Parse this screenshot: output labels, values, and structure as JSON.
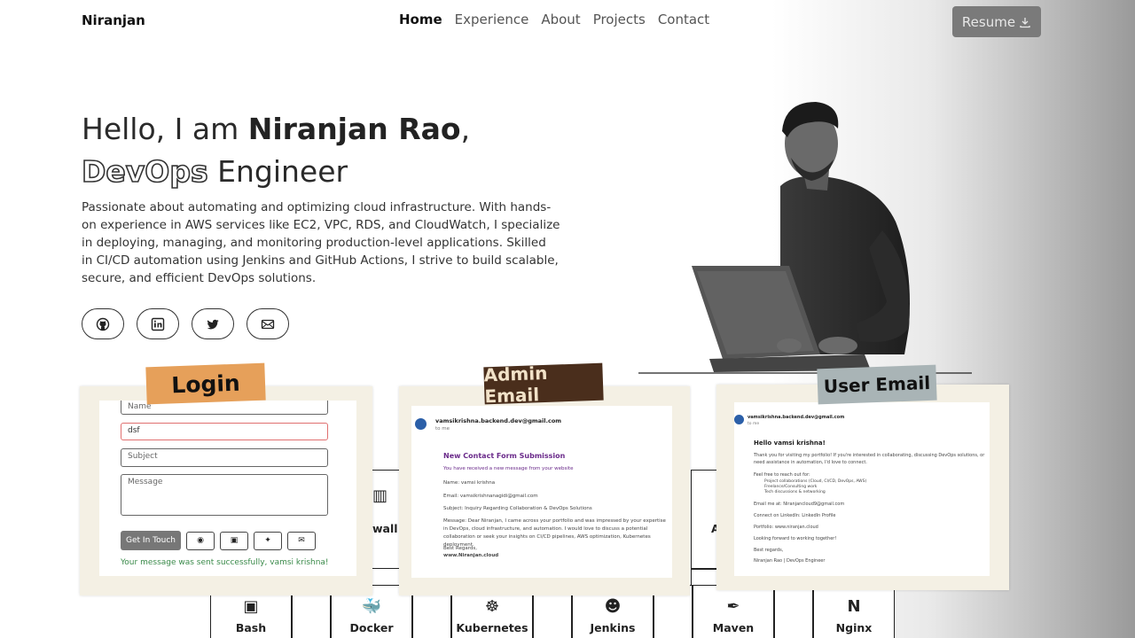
{
  "nav": {
    "brand": "Niranjan",
    "items": [
      "Home",
      "Experience",
      "About",
      "Projects",
      "Contact"
    ],
    "resume": "Resume",
    "active": "Home"
  },
  "hero": {
    "greeting": "Hello, I am ",
    "name": "Niranjan Rao",
    "comma": ",",
    "role_outline": "DevOps",
    "role_rest": "Engineer",
    "description": "Passionate about automating and optimizing cloud infrastructure. With hands-on experience in AWS services like EC2, VPC, RDS, and CloudWatch, I specialize in deploying, managing, and monitoring production-level applications. Skilled in CI/CD automation using Jenkins and GitHub Actions, I strive to build scalable, secure, and efficient DevOps solutions."
  },
  "login_card": {
    "label": "Login",
    "fields": {
      "name": "Name",
      "email": "dsf",
      "subject": "Subject",
      "message": "Message"
    },
    "submit": "Get In Touch",
    "success": "Your message was sent successfully,  vamsi krishna!"
  },
  "admin_card": {
    "label": "Admin Email",
    "sender": "vamsikrishna.backend.dev@gmail.com",
    "to": "to me",
    "heading": "New Contact Form Submission",
    "intro": "You have received a new message from your website",
    "name_line": "Name: vamsi krishna",
    "email_line": "Email: vamsikrishnanagidi@gmail.com",
    "subject_line": "Subject: Inquiry Regarding Collaboration & DevOps Solutions",
    "message_line": "Message: Dear Niranjan, I came across your portfolio and was impressed by your expertise in DevOps, cloud infrastructure, and automation. I would love to discuss a potential collaboration or seek your insights on CI/CD pipelines, AWS optimization, Kubernetes deployment.",
    "regards": "Best Regards,",
    "site": "www.Niranjan.cloud"
  },
  "user_card": {
    "label": "User Email",
    "sender": "vamsikrishna.backend.dev@gmail.com",
    "to": "to me",
    "hello": "Hello vamsi krishna!",
    "intro": "Thank you for visiting my portfolio! If you're interested in collaborating, discussing DevOps solutions, or need assistance in automation, I'd love to connect.",
    "reach": "Feel free to reach out for:",
    "bullets": [
      "Project collaborations (Cloud, CI/CD, DevOps, AWS)",
      "Freelance/Consulting work",
      "Tech discussions & networking"
    ],
    "email_me": "Email me at: Niranjancloud9@gmail.com",
    "linkedin": "Connect on LinkedIn: LinkedIn Profile",
    "portfolio": "Portfolio: www.niranjan.cloud",
    "forward": "Looking forward to working together!",
    "regards": "Best regards,",
    "signature": "Niranjan Rao | DevOps Engineer"
  },
  "skills": [
    "Bash",
    "Docker",
    "Kubernetes",
    "Jenkins",
    "Maven",
    "Nginx"
  ],
  "partial_skills": [
    "wall",
    "A"
  ]
}
